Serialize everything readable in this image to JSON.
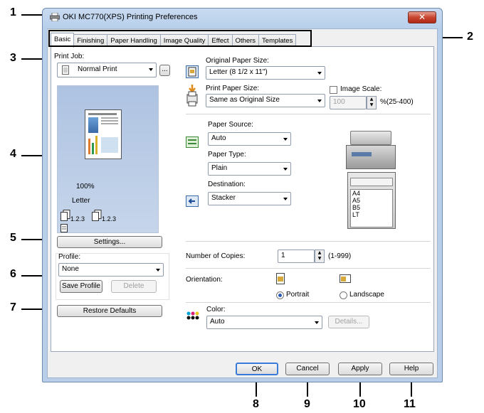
{
  "callouts": [
    "1",
    "2",
    "3",
    "4",
    "5",
    "6",
    "7",
    "8",
    "9",
    "10",
    "11"
  ],
  "window": {
    "title": "OKI MC770(XPS) Printing Preferences",
    "close_glyph": "✕"
  },
  "tabs": [
    "Basic",
    "Finishing",
    "Paper Handling",
    "Image Quality",
    "Effect",
    "Others",
    "Templates"
  ],
  "print_job": {
    "label": "Print Job:",
    "value": "Normal Print",
    "more_button": "..."
  },
  "preview": {
    "zoom": "100%",
    "paper": "Letter",
    "collate1": "1.2.3",
    "collate2": "1.2.3"
  },
  "settings_button": "Settings...",
  "profile": {
    "label": "Profile:",
    "value": "None",
    "save_button": "Save Profile",
    "delete_button": "Delete"
  },
  "restore_button": "Restore Defaults",
  "original_size": {
    "label": "Original Paper Size:",
    "value": "Letter (8 1/2 x 11\")"
  },
  "print_size": {
    "label": "Print Paper Size:",
    "value": "Same as Original Size"
  },
  "image_scale": {
    "label": "Image Scale:",
    "value": "100",
    "range": "%(25-400)"
  },
  "paper_source": {
    "label": "Paper Source:",
    "value": "Auto"
  },
  "paper_type": {
    "label": "Paper Type:",
    "value": "Plain"
  },
  "destination": {
    "label": "Destination:",
    "value": "Stacker"
  },
  "trays": [
    "A4",
    "A5",
    "B5",
    "LT"
  ],
  "copies": {
    "label": "Number of Copies:",
    "value": "1",
    "range": "(1-999)"
  },
  "orientation": {
    "label": "Orientation:",
    "portrait": "Portrait",
    "landscape": "Landscape"
  },
  "color": {
    "label": "Color:",
    "value": "Auto",
    "details_button": "Details..."
  },
  "footer": {
    "ok": "OK",
    "cancel": "Cancel",
    "apply": "Apply",
    "help": "Help"
  },
  "colors": {
    "accent": "#2a5ab8",
    "close": "#c8452f",
    "callout_box": "#000000"
  }
}
